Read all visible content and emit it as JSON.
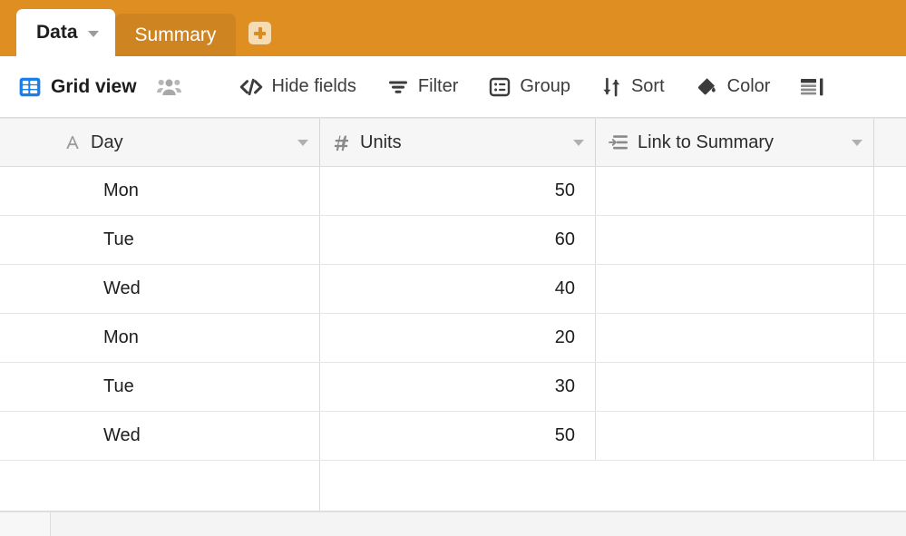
{
  "tabbar": {
    "background_color": "#df8e22",
    "tabs": [
      {
        "label": "Data",
        "active": true,
        "icon": "chevron-down-icon"
      },
      {
        "label": "Summary",
        "active": false
      }
    ],
    "add_tab_label": "+"
  },
  "toolbar": {
    "view_icon": "grid-view-icon",
    "view_name": "Grid view",
    "collaborators_icon": "collaborators-icon",
    "buttons": [
      {
        "label": "Hide fields",
        "icon": "code-brackets-icon"
      },
      {
        "label": "Filter",
        "icon": "filter-icon"
      },
      {
        "label": "Group",
        "icon": "group-icon"
      },
      {
        "label": "Sort",
        "icon": "sort-arrows-icon"
      },
      {
        "label": "Color",
        "icon": "paint-bucket-icon"
      }
    ],
    "row_height_icon": "row-height-icon"
  },
  "grid": {
    "columns": [
      {
        "name": "Day",
        "field_type_icon": "text-field-icon",
        "glyph": "A"
      },
      {
        "name": "Units",
        "field_type_icon": "number-field-icon",
        "glyph": "#"
      },
      {
        "name": "Link to Summary",
        "field_type_icon": "link-record-icon",
        "glyph": ""
      }
    ],
    "rows": [
      {
        "day": "Mon",
        "units": "50",
        "link": ""
      },
      {
        "day": "Tue",
        "units": "60",
        "link": ""
      },
      {
        "day": "Wed",
        "units": "40",
        "link": ""
      },
      {
        "day": "Mon",
        "units": "20",
        "link": ""
      },
      {
        "day": "Tue",
        "units": "30",
        "link": ""
      },
      {
        "day": "Wed",
        "units": "50",
        "link": ""
      }
    ]
  }
}
